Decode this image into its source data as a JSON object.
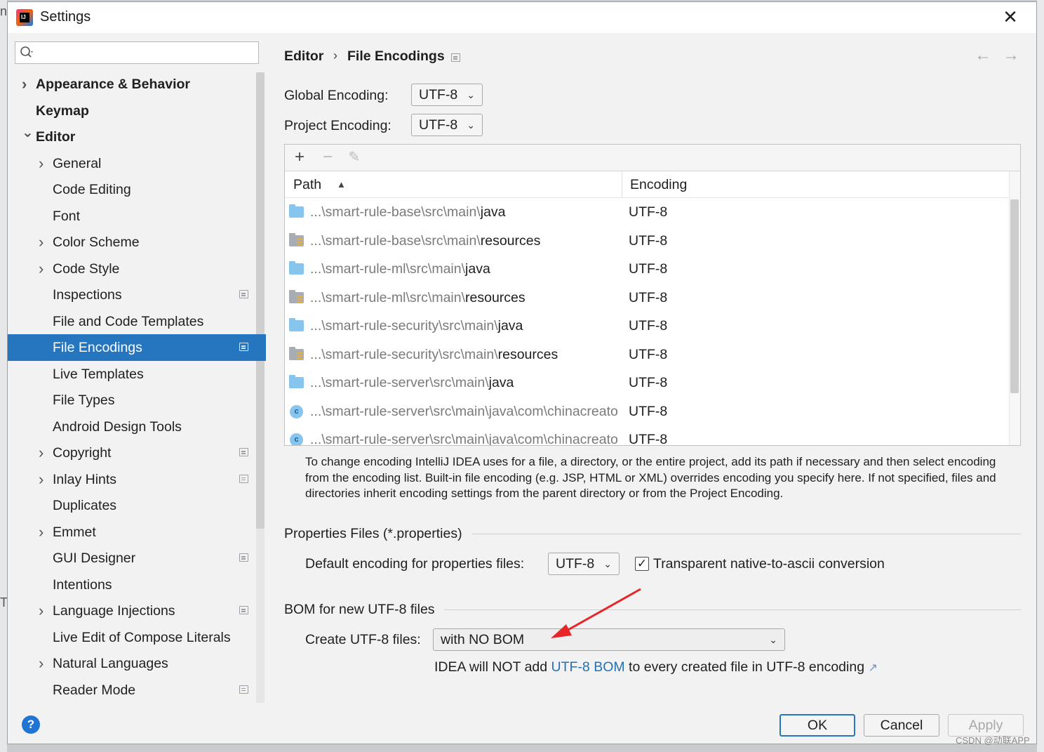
{
  "window": {
    "title": "Settings",
    "close": "✕"
  },
  "background": {
    "glyph1": "n",
    "glyph2": "Tr"
  },
  "search": {
    "value": "",
    "placeholder": ""
  },
  "tree": {
    "items": [
      {
        "label": "Appearance & Behavior",
        "expanded": false,
        "has_children": true
      },
      {
        "label": "Keymap"
      },
      {
        "label": "Editor",
        "expanded": true,
        "has_children": true
      },
      {
        "label": "General",
        "has_children": true
      },
      {
        "label": "Code Editing"
      },
      {
        "label": "Font"
      },
      {
        "label": "Color Scheme",
        "has_children": true
      },
      {
        "label": "Code Style",
        "has_children": true
      },
      {
        "label": "Inspections",
        "project_scoped": true
      },
      {
        "label": "File and Code Templates"
      },
      {
        "label": "File Encodings",
        "selected": true,
        "project_scoped": true
      },
      {
        "label": "Live Templates"
      },
      {
        "label": "File Types"
      },
      {
        "label": "Android Design Tools"
      },
      {
        "label": "Copyright",
        "has_children": true,
        "project_scoped": true
      },
      {
        "label": "Inlay Hints",
        "has_children": true,
        "project_scoped": true
      },
      {
        "label": "Duplicates"
      },
      {
        "label": "Emmet",
        "has_children": true
      },
      {
        "label": "GUI Designer",
        "project_scoped": true
      },
      {
        "label": "Intentions"
      },
      {
        "label": "Language Injections",
        "has_children": true,
        "project_scoped": true
      },
      {
        "label": "Live Edit of Compose Literals"
      },
      {
        "label": "Natural Languages",
        "has_children": true
      },
      {
        "label": "Reader Mode",
        "project_scoped": true
      }
    ]
  },
  "breadcrumb": {
    "parent": "Editor",
    "separator": "›",
    "current": "File Encodings"
  },
  "nav": {
    "back": "←",
    "forward": "→"
  },
  "encodings": {
    "global_label": "Global Encoding:",
    "global_value": "UTF-8",
    "project_label": "Project Encoding:",
    "project_value": "UTF-8"
  },
  "table": {
    "toolbar": {
      "add": "+",
      "remove": "−",
      "edit": "✎"
    },
    "headers": {
      "path": "Path",
      "sort": "▲",
      "encoding": "Encoding"
    },
    "rows": [
      {
        "icon": "java-folder",
        "dim": "...\\smart-rule-base\\src\\main\\",
        "strong": "java",
        "encoding": "UTF-8"
      },
      {
        "icon": "resources-folder",
        "dim": "...\\smart-rule-base\\src\\main\\",
        "strong": "resources",
        "encoding": "UTF-8"
      },
      {
        "icon": "java-folder",
        "dim": "...\\smart-rule-ml\\src\\main\\",
        "strong": "java",
        "encoding": "UTF-8"
      },
      {
        "icon": "resources-folder",
        "dim": "...\\smart-rule-ml\\src\\main\\",
        "strong": "resources",
        "encoding": "UTF-8"
      },
      {
        "icon": "java-folder",
        "dim": "...\\smart-rule-security\\src\\main\\",
        "strong": "java",
        "encoding": "UTF-8"
      },
      {
        "icon": "resources-folder",
        "dim": "...\\smart-rule-security\\src\\main\\",
        "strong": "resources",
        "encoding": "UTF-8"
      },
      {
        "icon": "java-folder",
        "dim": "...\\smart-rule-server\\src\\main\\",
        "strong": "java",
        "encoding": "UTF-8"
      },
      {
        "icon": "class",
        "dim": "...\\smart-rule-server\\src\\main\\java\\com\\chinacreato",
        "strong": "",
        "encoding": "UTF-8"
      },
      {
        "icon": "class",
        "dim": "...\\smart-rule-server\\src\\main\\java\\com\\chinacreato",
        "strong": "",
        "encoding": "UTF-8"
      }
    ]
  },
  "note": "To change encoding IntelliJ IDEA uses for a file, a directory, or the entire project, add its path if necessary and then select encoding from the encoding list. Built-in file encoding (e.g. JSP, HTML or XML) overrides encoding you specify here. If not specified, files and directories inherit encoding settings from the parent directory or from the Project Encoding.",
  "properties": {
    "section_title": "Properties Files (*.properties)",
    "default_label": "Default encoding for properties files:",
    "default_value": "UTF-8",
    "transparent_checked": true,
    "transparent_label": "Transparent native-to-ascii conversion"
  },
  "bom": {
    "section_title": "BOM for new UTF-8 files",
    "create_label": "Create UTF-8 files:",
    "create_value": "with NO BOM",
    "info_prefix": "IDEA will NOT add ",
    "info_link": "UTF-8 BOM",
    "info_suffix": " to every created file in UTF-8 encoding",
    "info_arrow": "↗"
  },
  "footer": {
    "help": "?",
    "ok": "OK",
    "cancel": "Cancel",
    "apply": "Apply"
  },
  "watermark": "CSDN @动联APP",
  "colors": {
    "selection": "#2675bf",
    "link": "#2470b3",
    "annotation_arrow": "#e8262a"
  }
}
